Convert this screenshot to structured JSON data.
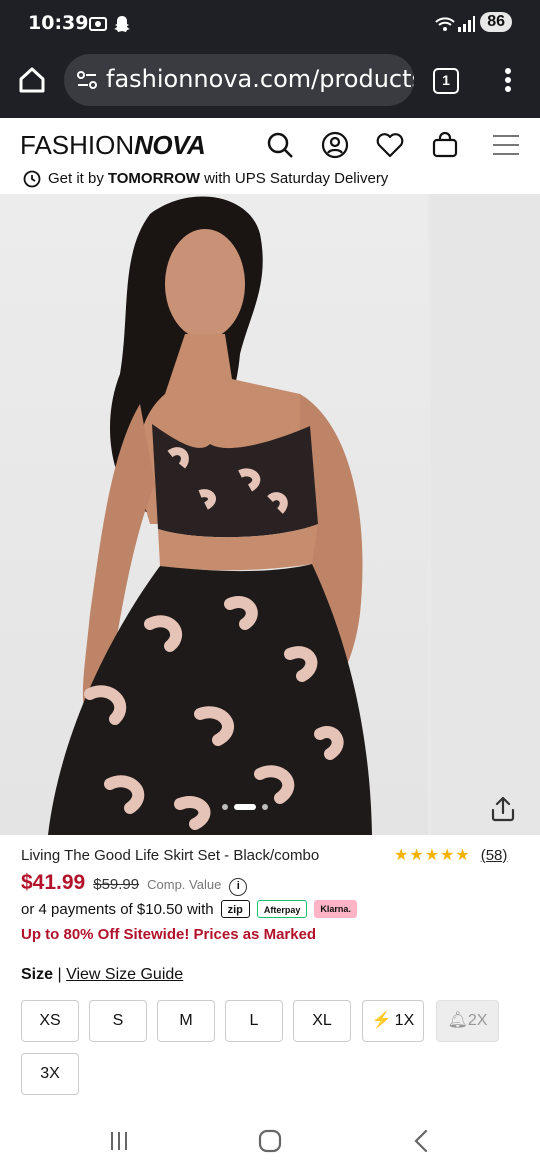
{
  "status_bar": {
    "time": "10:39",
    "battery": "86"
  },
  "browser": {
    "url": "fashionnova.com/products/l",
    "tab_count": "1"
  },
  "site": {
    "logo_part1": "FASHION",
    "logo_part2": "NOVA",
    "delivery_prefix": "Get it by",
    "delivery_bold": "TOMORROW",
    "delivery_suffix": "with UPS Saturday Delivery"
  },
  "product": {
    "title": "Living The Good Life Skirt Set - Black/combo",
    "rating_stars": "★★★★★",
    "reviews": "(58)",
    "price": "$41.99",
    "old_price": "$59.99",
    "comp_label": "Comp. Value",
    "installments": "or 4 payments of $10.50 with",
    "pay_zip": "zip",
    "pay_afterpay": "Afterpay",
    "pay_klarna": "Klarna.",
    "promo": "Up to 80% Off Sitewide! Prices as Marked"
  },
  "size": {
    "label": "Size",
    "separator": "|",
    "guide": "View Size Guide",
    "options": [
      "XS",
      "S",
      "M",
      "L",
      "XL",
      "1X",
      "2X",
      "3X"
    ]
  },
  "colors": {
    "accent": "#b3122b",
    "star": "#f5b301"
  }
}
